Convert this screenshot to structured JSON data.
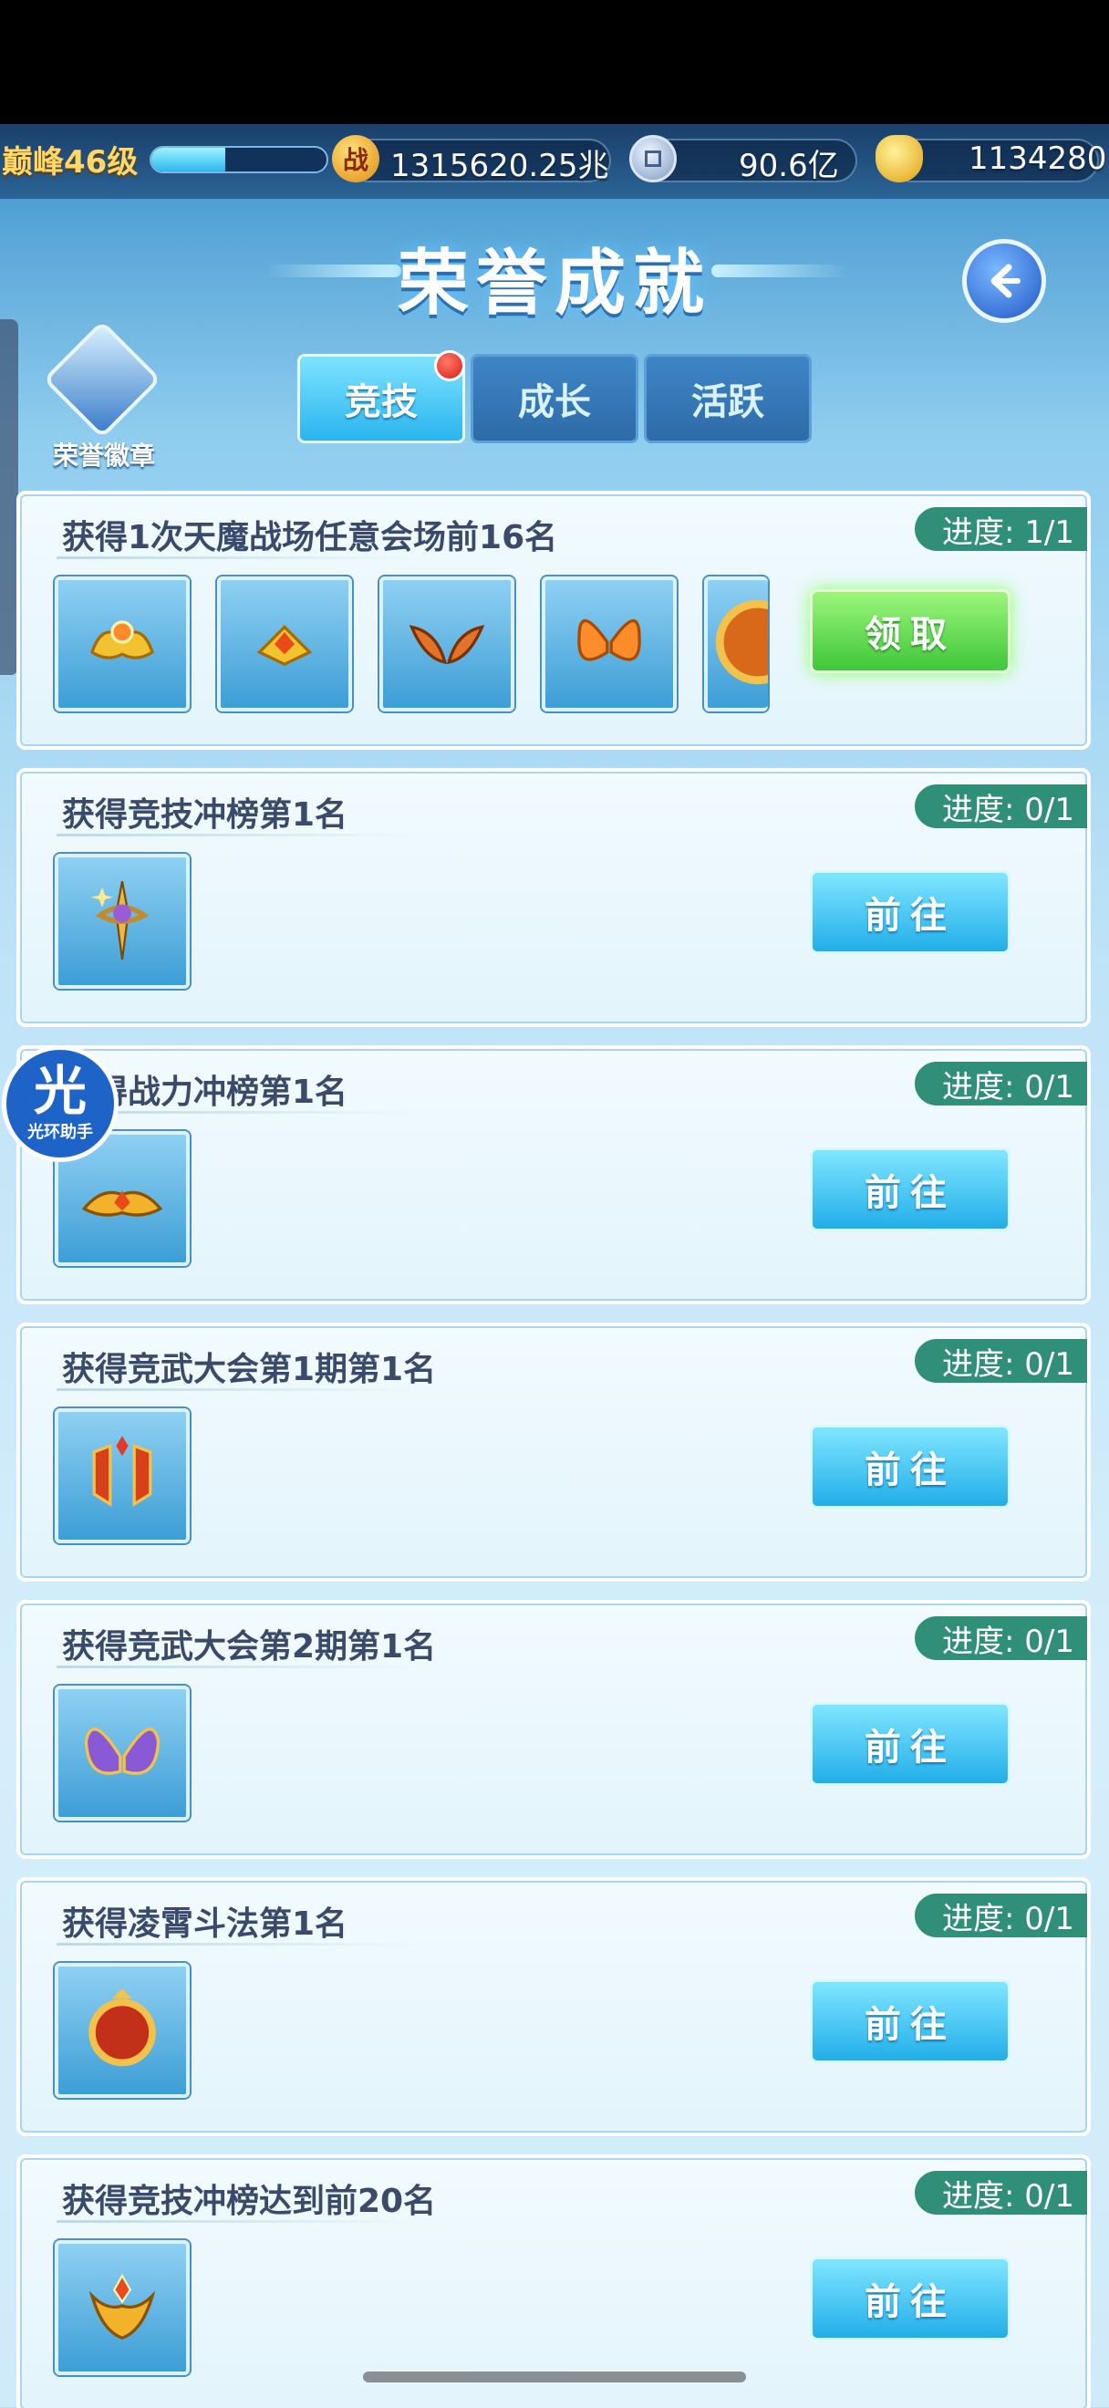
{
  "status": {
    "level_label": "巅峰46级",
    "exp_progress": 0.42
  },
  "resources": [
    {
      "icon": "battle-power-icon",
      "glyph": "战",
      "value": "1315620.25兆"
    },
    {
      "icon": "coin-icon",
      "glyph": "",
      "value": "90.6亿"
    },
    {
      "icon": "gold-ingot-icon",
      "glyph": "",
      "value": "1134280"
    }
  ],
  "header": {
    "title": "荣誉成就",
    "badge_label": "荣誉徽章"
  },
  "tabs": [
    {
      "label": "竞技",
      "active": true,
      "has_notification": true
    },
    {
      "label": "成长",
      "active": false
    },
    {
      "label": "活跃",
      "active": false
    }
  ],
  "achievements": [
    {
      "title": "获得1次天魔战场任意会场前16名",
      "progress": "进度: 1/1",
      "action": "领取",
      "action_type": "claim",
      "rewards": [
        "crown-ornament-icon",
        "gem-crest-icon",
        "wing-ornament-icon",
        "butterfly-wings-icon",
        "round-medal-icon"
      ]
    },
    {
      "title": "获得竞技冲榜第1名",
      "progress": "进度: 0/1",
      "action": "前往",
      "action_type": "go",
      "rewards": [
        "star-scepter-icon"
      ]
    },
    {
      "title": "获得战力冲榜第1名",
      "progress": "进度: 0/1",
      "action": "前往",
      "action_type": "go",
      "rewards": [
        "golden-crown-icon"
      ]
    },
    {
      "title": "获得竞武大会第1期第1名",
      "progress": "进度: 0/1",
      "action": "前往",
      "action_type": "go",
      "rewards": [
        "red-banner-icon"
      ]
    },
    {
      "title": "获得竞武大会第2期第1名",
      "progress": "进度: 0/1",
      "action": "前往",
      "action_type": "go",
      "rewards": [
        "purple-wings-icon"
      ]
    },
    {
      "title": "获得凌霄斗法第1名",
      "progress": "进度: 0/1",
      "action": "前往",
      "action_type": "go",
      "rewards": [
        "red-orb-frame-icon"
      ]
    },
    {
      "title": "获得竞技冲榜达到前20名",
      "progress": "进度: 0/1",
      "action": "前往",
      "action_type": "go",
      "rewards": [
        "gold-helm-crest-icon"
      ]
    }
  ],
  "overlay": {
    "glyph": "光",
    "label": "光环助手"
  },
  "colors": {
    "claim_button": "#3fc73b",
    "go_button": "#22aee9",
    "progress_tag": "#2f8f79",
    "title_text": "#3b4a6b"
  }
}
